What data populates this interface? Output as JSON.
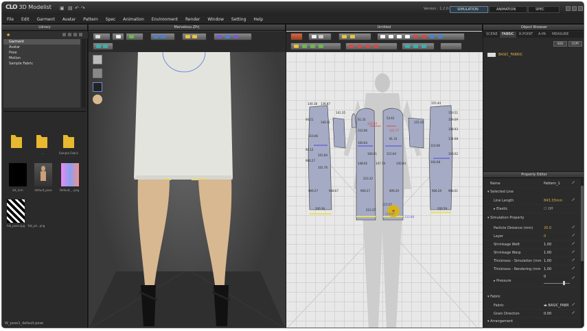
{
  "app": {
    "title": "3D Modelist",
    "version": "Version : 1.2.0.0"
  },
  "modes": [
    "SIMULATION",
    "ANIMATION",
    "SPEC"
  ],
  "menu": [
    "File",
    "Edit",
    "Garment",
    "Avatar",
    "Pattern",
    "Spec",
    "Animation",
    "Environment",
    "Render",
    "Window",
    "Setting",
    "Help"
  ],
  "library": {
    "title": "Library",
    "tree": [
      "Garment",
      "Avatar",
      "Pose",
      "Motion",
      "Sample Fabric"
    ],
    "selected": "Garment",
    "thumbs": [
      {
        "label": "",
        "kind": "folder"
      },
      {
        "label": "...",
        "kind": "folder"
      },
      {
        "label": "Sample Fabric",
        "kind": "folder"
      },
      {
        "label": "bit_nrm",
        "kind": "black"
      },
      {
        "label": "default_pose",
        "kind": "avatar"
      },
      {
        "label": "Default_...png",
        "kind": "gradient"
      },
      {
        "label": "fab_pose.zpg",
        "kind": "zebra"
      },
      {
        "label": "fab_pk...png",
        "kind": "none"
      }
    ],
    "footer": "W_pose1_default.pose"
  },
  "view3d": {
    "title": "Marvelous.ZPrj"
  },
  "view2d": {
    "title": "Untitled"
  },
  "object_browser": {
    "title": "Object Browser",
    "tabs": [
      "SCENE",
      "FABRIC",
      "R-POINT",
      "A-PA",
      "MEASURE"
    ],
    "active_tab": "FABRIC",
    "add_label": "ADD",
    "copy_label": "COPY",
    "fabric_item": "BASIC_FABRIC"
  },
  "property_editor": {
    "title": "Property Editor",
    "name_key": "Name",
    "name_value": "Pattern_1",
    "sections": {
      "selected_line": "Selected Line",
      "simulation": "Simulation Property",
      "fabric": "Fabric",
      "arrangement": "Arrangement"
    },
    "line_length": {
      "k": "Line Length",
      "v": "843.33mm"
    },
    "elastic": {
      "k": "Elastic",
      "v": "Off"
    },
    "rows": [
      {
        "k": "Particle Distance (mm)",
        "v": "20.0"
      },
      {
        "k": "Layer",
        "v": "0"
      },
      {
        "k": "Shrinkage Weft",
        "v": "1.00"
      },
      {
        "k": "Shrinkage Warp",
        "v": "1.00"
      },
      {
        "k": "Thickness - Simulation (mm",
        "v": "1.00"
      },
      {
        "k": "Thickness - Rendering (mm",
        "v": "1.00"
      }
    ],
    "pressure": {
      "k": "Pressure",
      "v": "0"
    },
    "fabric_row": {
      "k": "Fabric",
      "v": "BASIC_FABR"
    },
    "grain": {
      "k": "Grain Direction",
      "v": "0.00"
    }
  },
  "measurements": {
    "panel1": [
      "140.18",
      "136.87",
      "94.51",
      "140.31",
      "110.06",
      "90.12",
      "101.84",
      "960.27",
      "101.76",
      "909.27",
      "908.67",
      "200.36"
    ],
    "panel2": [
      "141.35",
      "61.33",
      "124.93",
      "53.61",
      "110.06",
      "122.77",
      "100.64",
      "81.33",
      "100.81",
      "115.64",
      "148.02",
      "147.74",
      "130.84",
      "909.27",
      "909.29",
      "223.32",
      "215.37",
      "115.57",
      "219.97",
      "133.88"
    ],
    "panel3": [
      "155.35",
      "155.44",
      "119.51",
      "109.09",
      "108.93",
      "131.68",
      "110.06",
      "100.62",
      "104.68",
      "906.29",
      "908.61",
      "200.59"
    ],
    "selected": [
      "219.97",
      "133.88"
    ]
  },
  "colors": {
    "accent": "#e0b040",
    "panel": "#9ca3c0",
    "selected": "#e8e060"
  }
}
